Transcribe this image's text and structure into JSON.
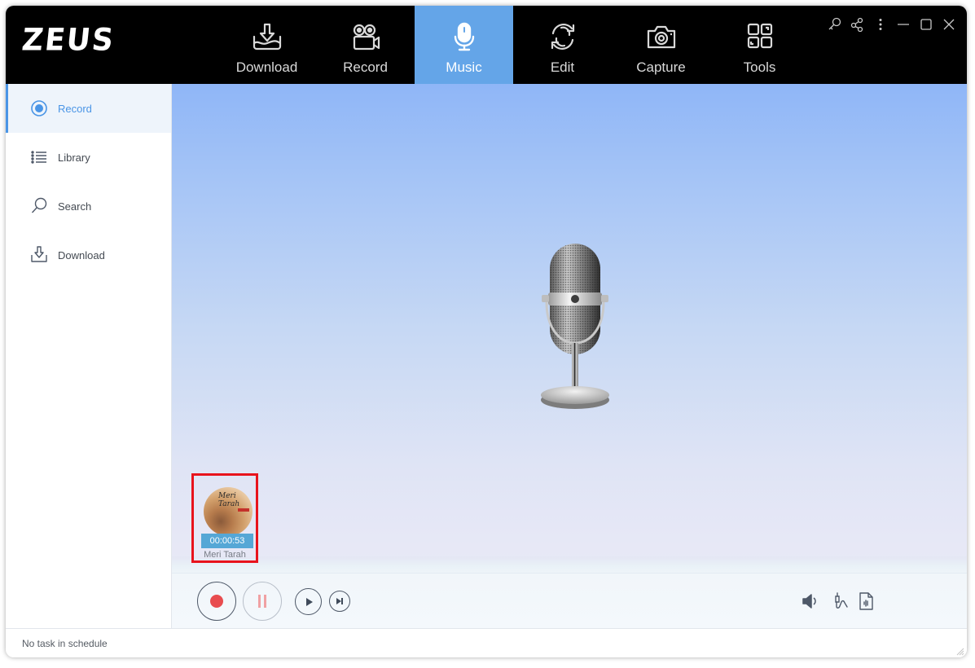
{
  "app": {
    "logo": "ZEUS"
  },
  "nav": {
    "tabs": [
      {
        "label": "Download",
        "icon": "download-tray-icon",
        "active": false
      },
      {
        "label": "Record",
        "icon": "video-camera-icon",
        "active": false
      },
      {
        "label": "Music",
        "icon": "microphone-icon",
        "active": true
      },
      {
        "label": "Edit",
        "icon": "refresh-cycle-icon",
        "active": false
      },
      {
        "label": "Capture",
        "icon": "camera-icon",
        "active": false
      },
      {
        "label": "Tools",
        "icon": "grid-tools-icon",
        "active": false
      }
    ],
    "active_color": "#64a5e8"
  },
  "window_controls": [
    "key-icon",
    "share-icon",
    "more-vertical-icon",
    "minimize-icon",
    "maximize-icon",
    "close-icon"
  ],
  "sidebar": {
    "items": [
      {
        "label": "Record",
        "icon": "radio-record-icon",
        "active": true
      },
      {
        "label": "Library",
        "icon": "list-icon",
        "active": false
      },
      {
        "label": "Search",
        "icon": "search-icon",
        "active": false
      },
      {
        "label": "Download",
        "icon": "download-icon",
        "active": false
      }
    ],
    "accent": "#4a95e6"
  },
  "main": {
    "illustration": "vintage-microphone",
    "task": {
      "cover_title": "Meri Tarah",
      "time": "00:00:53",
      "name": "Meri Tarah"
    },
    "controls": {
      "record": "record-button",
      "pause": "pause-button",
      "play": "play-button",
      "next": "skip-next-button",
      "right": [
        "speaker-icon",
        "audio-jack-icon",
        "audio-file-icon"
      ]
    }
  },
  "status": {
    "text": "No task in schedule"
  }
}
